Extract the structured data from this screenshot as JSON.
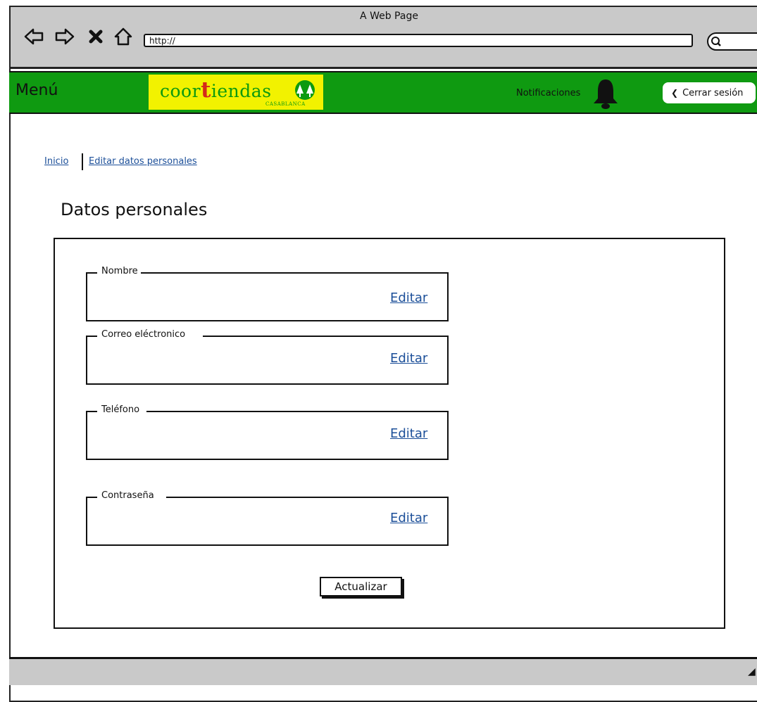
{
  "browser": {
    "window_title": "A Web Page",
    "url": "http://"
  },
  "app_bar": {
    "menu_label": "Menú",
    "logo": {
      "word_before": "coor",
      "word_letter": "t",
      "word_after": "iendas",
      "subtitle": "CASABLANCA"
    },
    "notifications_label": "Notificaciones",
    "logout_label": "Cerrar sesión"
  },
  "breadcrumb": {
    "items": [
      {
        "label": "Inicio"
      },
      {
        "label": "Editar datos personales"
      }
    ]
  },
  "page_title": "Datos personales",
  "form": {
    "fields": [
      {
        "legend": "Nombre",
        "edit_label": "Editar"
      },
      {
        "legend": "Correo eléctronico",
        "edit_label": "Editar"
      },
      {
        "legend": "Teléfono",
        "edit_label": "Editar"
      },
      {
        "legend": "Contraseña",
        "edit_label": "Editar"
      }
    ],
    "submit_label": "Actualizar"
  },
  "colors": {
    "app_bar": "#0f9a11",
    "logo_background": "#f2f200",
    "link": "#1c4f99",
    "chrome": "#c9c9c9"
  },
  "icons": [
    "back-arrow-icon",
    "forward-arrow-icon",
    "close-icon",
    "home-icon",
    "search-icon",
    "bell-icon",
    "chevron-left-icon",
    "tree-icon"
  ]
}
